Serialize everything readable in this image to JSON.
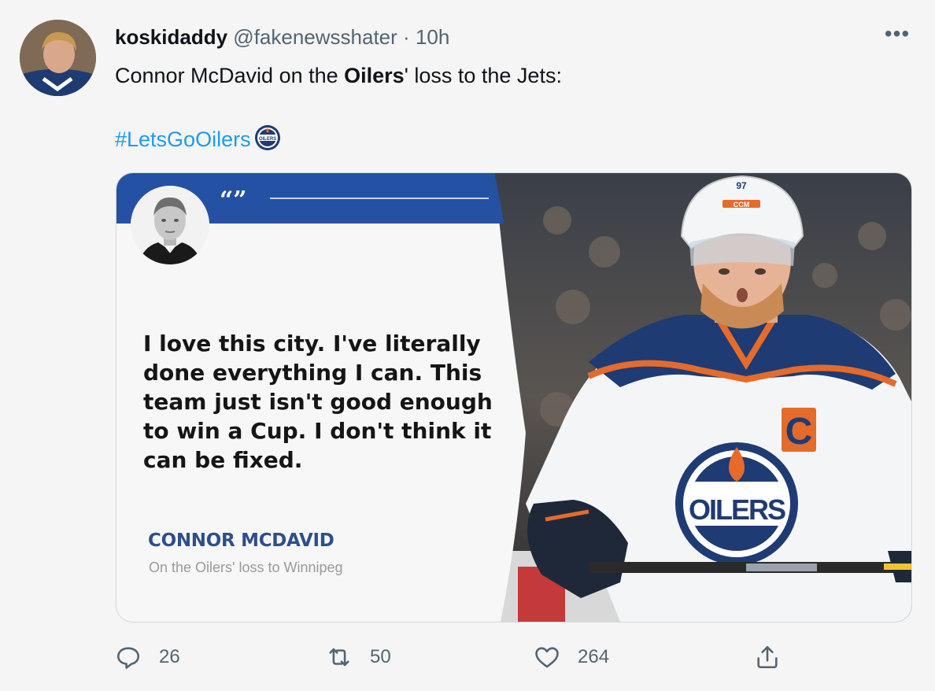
{
  "tweet": {
    "display_name": "koskidaddy",
    "handle": "@fakenewsshater",
    "separator": "·",
    "time": "10h",
    "more_label": "•••",
    "text_before": "Connor McDavid on the ",
    "text_bold": "Oilers",
    "text_after": "' loss to the Jets:",
    "hashtag": "#LetsGoOilers"
  },
  "card": {
    "quote_marks": "“”",
    "quote": "I love this city. I've literally done everything I can. This team just isn't good enough to win a Cup. I don't think it can be fixed.",
    "author": "CONNOR MCDAVID",
    "subtitle": "On the Oilers' loss to Winnipeg",
    "jersey_text": "OILERS",
    "helmet_brand": "CCM",
    "helmet_number": "97",
    "captain_letter": "C"
  },
  "actions": {
    "replies": "26",
    "retweets": "50",
    "likes": "264"
  },
  "colors": {
    "link": "#1d9bf0",
    "muted": "#536471",
    "oilers_blue": "#2551a4",
    "oilers_orange": "#e56b2a"
  },
  "icons": [
    "more-icon",
    "oilers-logo-icon",
    "reply-icon",
    "retweet-icon",
    "like-icon",
    "share-icon"
  ]
}
